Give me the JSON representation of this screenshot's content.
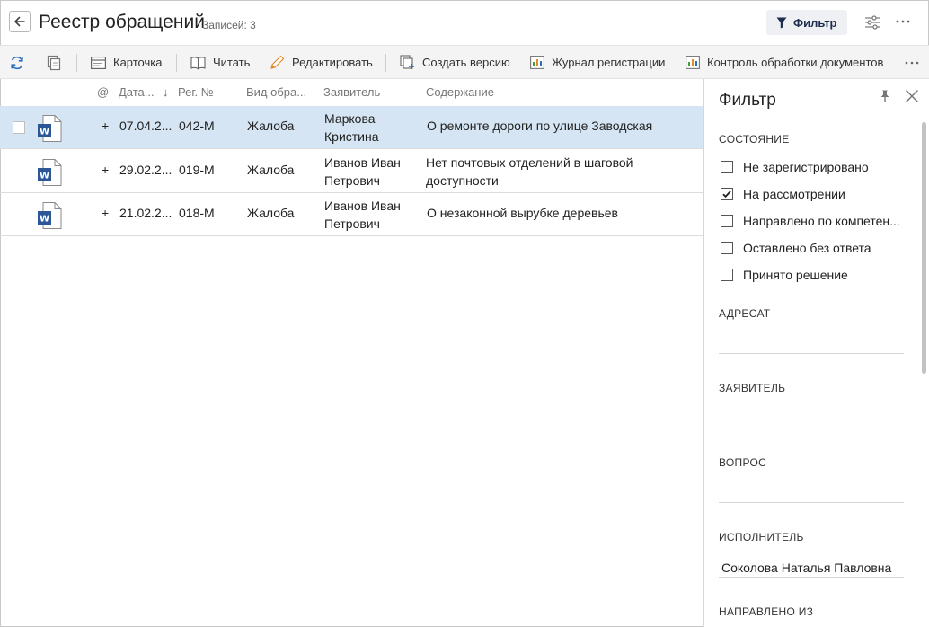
{
  "header": {
    "title": "Реестр обращений",
    "records_label": "Записей: 3",
    "filter_button": "Фильтр"
  },
  "toolbar": {
    "card": "Карточка",
    "read": "Читать",
    "edit": "Редактировать",
    "create_version": "Создать версию",
    "registration_log": "Журнал регистрации",
    "processing_control": "Контроль обработки документов"
  },
  "table": {
    "columns": {
      "attach": "@",
      "date": "Дата...",
      "sort_arrow": "↓",
      "reg_no": "Рег. №",
      "type": "Вид обра...",
      "applicant": "Заявитель",
      "content": "Содержание"
    },
    "rows": [
      {
        "plus": "+",
        "date": "07.04.2...",
        "reg_no": "042-М",
        "type": "Жалоба",
        "applicant": "Маркова Кристина",
        "content": "О ремонте дороги по улице Заводская"
      },
      {
        "plus": "+",
        "date": "29.02.2...",
        "reg_no": "019-М",
        "type": "Жалоба",
        "applicant": "Иванов Иван Петрович",
        "content": "Нет почтовых отделений в шаговой доступности"
      },
      {
        "plus": "+",
        "date": "21.02.2...",
        "reg_no": "018-М",
        "type": "Жалоба",
        "applicant": "Иванов Иван Петрович",
        "content": "О незаконной вырубке деревьев"
      }
    ]
  },
  "filter": {
    "title": "Фильтр",
    "state_label": "СОСТОЯНИЕ",
    "states": [
      {
        "label": "Не зарегистрировано",
        "checked": false
      },
      {
        "label": "На рассмотрении",
        "checked": true
      },
      {
        "label": "Направлено по компетен...",
        "checked": false
      },
      {
        "label": "Оставлено без ответа",
        "checked": false
      },
      {
        "label": "Принято решение",
        "checked": false
      }
    ],
    "addressee_label": "АДРЕСАТ",
    "addressee_value": "",
    "applicant_label": "ЗАЯВИТЕЛЬ",
    "applicant_value": "",
    "question_label": "ВОПРОС",
    "question_value": "",
    "executor_label": "ИСПОЛНИТЕЛЬ",
    "executor_value": "Соколова Наталья Павловна",
    "directed_from_label": "НАПРАВЛЕНО ИЗ"
  },
  "colors": {
    "selected_row": "#d5e5f3",
    "accent_blue": "#2a6ebb",
    "word_blue": "#2b5797",
    "chart_green": "#4a9a3c",
    "chart_orange": "#e08a2a"
  }
}
